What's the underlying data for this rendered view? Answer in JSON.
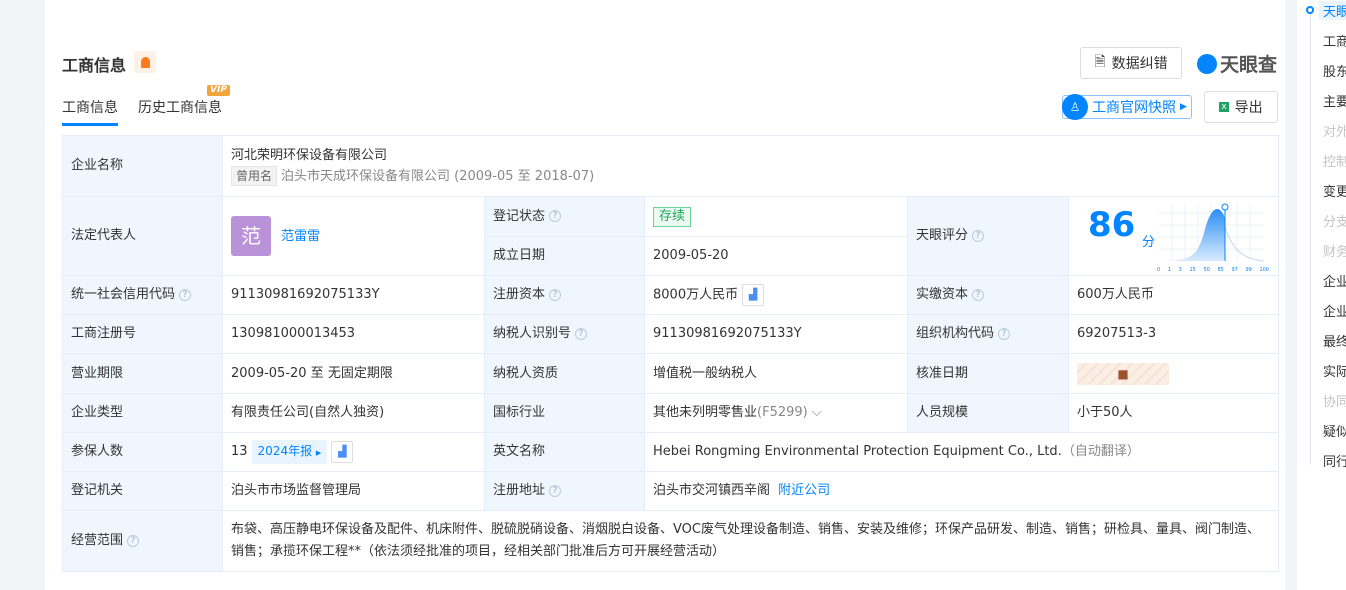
{
  "header": {
    "title": "工商信息",
    "correction_label": "数据纠错",
    "logo_text": "天眼查",
    "snapshot_label": "工商官网快照",
    "export_label": "导出",
    "vip_badge": "VIP"
  },
  "tabs": [
    {
      "label": "工商信息",
      "active": true
    },
    {
      "label": "历史工商信息"
    }
  ],
  "company": {
    "name_label": "企业名称",
    "name": "河北荣明环保设备有限公司",
    "former_tag": "曾用名",
    "former_name": "泊头市天成环保设备有限公司 (2009-05 至 2018-07)",
    "legal_label": "法定代表人",
    "legal_avatar": "范",
    "legal_name": "范雷雷",
    "status_label": "登记状态",
    "status": "存续",
    "founded_label": "成立日期",
    "founded": "2009-05-20",
    "score_label": "天眼评分",
    "score": "86",
    "score_unit": "分",
    "score_ticks": [
      "0",
      "1",
      "3",
      "15",
      "50",
      "85",
      "97",
      "99",
      "100"
    ],
    "credit_label": "统一社会信用代码",
    "credit": "91130981692075133Y",
    "regcap_label": "注册资本",
    "regcap": "8000万人民币",
    "paidcap_label": "实缴资本",
    "paidcap": "600万人民币",
    "regno_label": "工商注册号",
    "regno": "130981000013453",
    "taxid_label": "纳税人识别号",
    "taxid": "91130981692075133Y",
    "orgcode_label": "组织机构代码",
    "orgcode": "69207513-3",
    "term_label": "营业期限",
    "term": "2009-05-20 至 无固定期限",
    "taxqual_label": "纳税人资质",
    "taxqual": "增值税一般纳税人",
    "approve_label": "核准日期",
    "type_label": "企业类型",
    "type": "有限责任公司(自然人独资)",
    "industry_label": "国标行业",
    "industry": "其他未列明零售业",
    "industry_code": "(F5299)",
    "staff_label": "人员规模",
    "staff": "小于50人",
    "insured_label": "参保人数",
    "insured": "13",
    "report": "2024年报",
    "en_label": "英文名称",
    "en_name": "Hebei Rongming Environmental Protection Equipment Co., Ltd.",
    "en_note": "（自动翻译）",
    "authority_label": "登记机关",
    "authority": "泊头市市场监督管理局",
    "address_label": "注册地址",
    "address": "泊头市交河镇西辛阁",
    "nearby": "附近公司",
    "scope_label": "经营范围",
    "scope": "布袋、高压静电环保设备及配件、机床附件、脱硫脱硝设备、消烟脱白设备、VOC废气处理设备制造、销售、安装及维修；环保产品研发、制造、销售；研检具、量具、阀门制造、销售；承揽环保工程**（依法须经批准的项目，经相关部门批准后方可开展经营活动）"
  },
  "nav": [
    {
      "label": "天眼",
      "state": "active"
    },
    {
      "label": "工商"
    },
    {
      "label": "股东"
    },
    {
      "label": "主要"
    },
    {
      "label": "对外",
      "state": "disabled"
    },
    {
      "label": "控制",
      "state": "disabled"
    },
    {
      "label": "变更"
    },
    {
      "label": "分支",
      "state": "disabled"
    },
    {
      "label": "财务",
      "state": "disabled"
    },
    {
      "label": "企业"
    },
    {
      "label": "企业"
    },
    {
      "label": "最终"
    },
    {
      "label": "实际"
    },
    {
      "label": "协同",
      "state": "disabled"
    },
    {
      "label": "疑似"
    },
    {
      "label": "同行"
    }
  ]
}
